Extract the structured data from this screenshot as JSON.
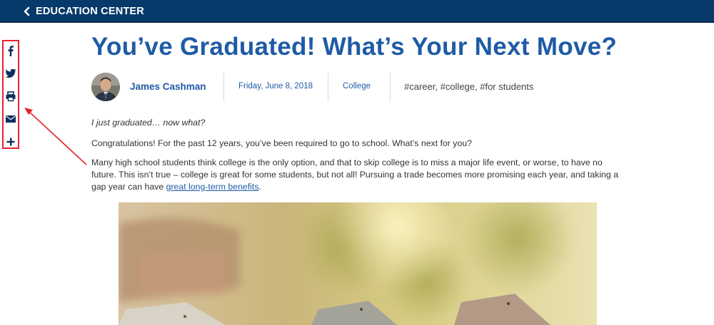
{
  "header": {
    "back_label": "EDUCATION CENTER",
    "background": "#053a6b"
  },
  "share": {
    "items": [
      "facebook-icon",
      "twitter-icon",
      "print-icon",
      "email-icon",
      "plus-icon"
    ],
    "highlight_color": "#e8242c"
  },
  "article": {
    "title": "You’ve Graduated! What’s Your Next Move?",
    "author": "James Cashman",
    "date": "Friday, June 8, 2018",
    "category": "College",
    "tags": "#career, #college, #for students",
    "lead": "I just graduated… now what?",
    "para1": "Congratulations! For the past 12 years, you’ve been required to go to school. What’s next for you?",
    "para2_before": "Many high school students think college is the only option, and that to skip college is to miss a major life event, or worse, to have no future. This isn’t true – college is great for some students, but not all! Pursuing a trade becomes more promising each year, and taking a gap year can have ",
    "para2_link": "great long-term benefits",
    "para2_after": ".",
    "accent_color": "#1f5ba6"
  }
}
